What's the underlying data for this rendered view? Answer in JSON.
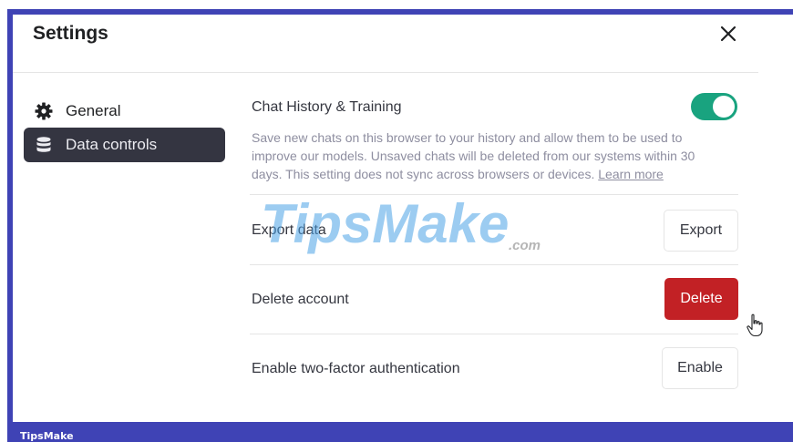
{
  "dialog": {
    "title": "Settings"
  },
  "sidebar": {
    "items": [
      {
        "label": "General",
        "icon": "gear-icon",
        "selected": false
      },
      {
        "label": "Data controls",
        "icon": "database-icon",
        "selected": true
      }
    ]
  },
  "chat_history": {
    "label": "Chat History & Training",
    "enabled": true,
    "description": "Save new chats on this browser to your history and allow them to be used to improve our models. Unsaved chats will be deleted from our systems within 30 days. This setting does not sync across browsers or devices.",
    "learn_more": "Learn more"
  },
  "export": {
    "label": "Export data",
    "button": "Export"
  },
  "delete_account": {
    "label": "Delete account",
    "button": "Delete"
  },
  "two_factor": {
    "label": "Enable two-factor authentication",
    "button": "Enable"
  },
  "watermark": {
    "brand": "TipsMake",
    "suffix": ".com"
  },
  "footer": {
    "brand": "TipsMake"
  },
  "colors": {
    "frame": "#3f43b5",
    "toggle_on": "#19a37f",
    "danger": "#c22125",
    "selected_item": "#343541"
  }
}
